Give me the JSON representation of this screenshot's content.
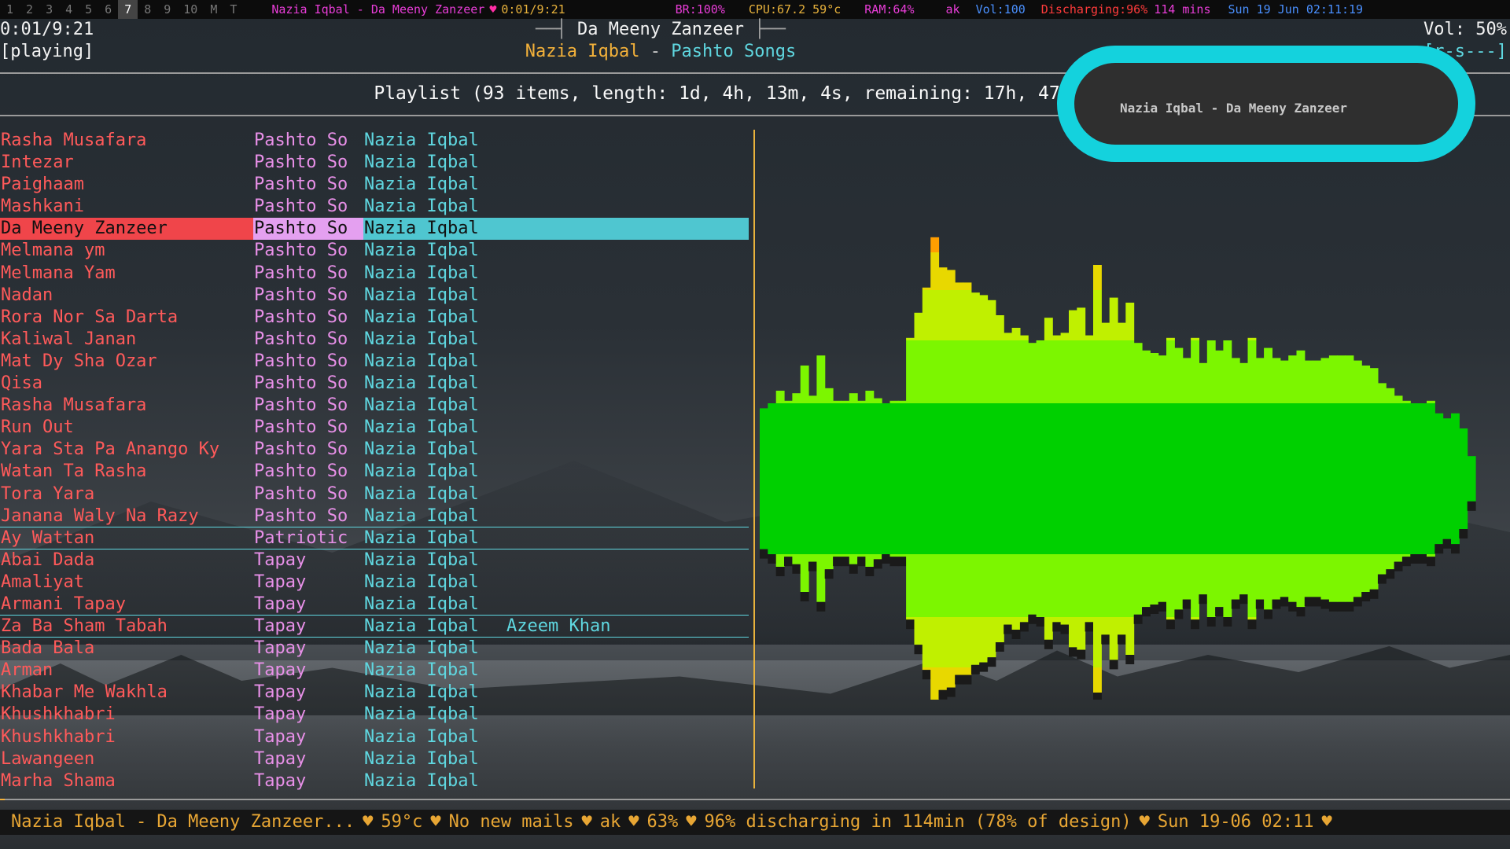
{
  "topbar": {
    "workspaces": [
      "1",
      "2",
      "3",
      "4",
      "5",
      "6",
      "7",
      "8",
      "9",
      "10",
      "M",
      "T"
    ],
    "active_workspace": "7",
    "now_playing": "Nazia Iqbal - Da Meeny Zanzeer",
    "heart": "♥",
    "time": "0:01/9:21",
    "brightness": "BR:100%",
    "cpu": "CPU:67.2 59°c",
    "ram": "RAM:64%",
    "user": "ak",
    "volume": "Vol:100",
    "battery_label": "Discharging:",
    "battery_pct": "96%",
    "battery_time": "114 mins",
    "datetime": "Sun 19 Jun 02:11:19"
  },
  "player": {
    "elapsed": "0:01/9:21",
    "state": "[playing]",
    "title": "Da Meeny Zanzeer",
    "artist": "Nazia Iqbal",
    "separator": "-",
    "album": "Pashto Songs",
    "volume": "Vol: 50%",
    "flags": "[r-s---]",
    "progress": 0.002
  },
  "playlist": {
    "header": "Playlist (93 items, length: 1d, 4h, 13m, 4s, remaining: 17h, 47m, 53s)",
    "rows": [
      {
        "title": "Rasha Musafara",
        "album": "Pashto So",
        "artist": "Nazia Iqbal",
        "extra": ""
      },
      {
        "title": "Intezar",
        "album": "Pashto So",
        "artist": "Nazia Iqbal",
        "extra": ""
      },
      {
        "title": "Paighaam",
        "album": "Pashto So",
        "artist": "Nazia Iqbal",
        "extra": ""
      },
      {
        "title": "Mashkani",
        "album": "Pashto So",
        "artist": "Nazia Iqbal",
        "extra": ""
      },
      {
        "title": "Da Meeny Zanzeer",
        "album": "Pashto So",
        "artist": "Nazia Iqbal",
        "extra": "",
        "selected": true
      },
      {
        "title": "Melmana ym",
        "album": "Pashto So",
        "artist": "Nazia Iqbal",
        "extra": ""
      },
      {
        "title": "Melmana Yam",
        "album": "Pashto So",
        "artist": "Nazia Iqbal",
        "extra": ""
      },
      {
        "title": "Nadan",
        "album": "Pashto So",
        "artist": "Nazia Iqbal",
        "extra": ""
      },
      {
        "title": "Rora Nor Sa Darta",
        "album": "Pashto So",
        "artist": "Nazia Iqbal",
        "extra": ""
      },
      {
        "title": "Kaliwal Janan",
        "album": "Pashto So",
        "artist": "Nazia Iqbal",
        "extra": ""
      },
      {
        "title": "Mat Dy Sha Ozar",
        "album": "Pashto So",
        "artist": "Nazia Iqbal",
        "extra": ""
      },
      {
        "title": "Qisa",
        "album": "Pashto So",
        "artist": "Nazia Iqbal",
        "extra": ""
      },
      {
        "title": "Rasha Musafara",
        "album": "Pashto So",
        "artist": "Nazia Iqbal",
        "extra": ""
      },
      {
        "title": "Run Out",
        "album": "Pashto So",
        "artist": "Nazia Iqbal",
        "extra": ""
      },
      {
        "title": "Yara Sta Pa Anango Ky",
        "album": "Pashto So",
        "artist": "Nazia Iqbal",
        "extra": ""
      },
      {
        "title": "Watan Ta Rasha",
        "album": "Pashto So",
        "artist": "Nazia Iqbal",
        "extra": ""
      },
      {
        "title": "Tora Yara",
        "album": "Pashto So",
        "artist": "Nazia Iqbal",
        "extra": ""
      },
      {
        "title": "Janana Waly Na Razy",
        "album": "Pashto So",
        "artist": "Nazia Iqbal",
        "extra": "",
        "underline": true
      },
      {
        "title": "Ay Wattan",
        "album": "Patriotic",
        "artist": "Nazia Iqbal",
        "extra": "",
        "underline": true
      },
      {
        "title": "Abai Dada",
        "album": "Tapay",
        "artist": "Nazia Iqbal",
        "extra": ""
      },
      {
        "title": "Amaliyat",
        "album": "Tapay",
        "artist": "Nazia Iqbal",
        "extra": ""
      },
      {
        "title": "Armani Tapay",
        "album": "Tapay",
        "artist": "Nazia Iqbal",
        "extra": "",
        "underline": true
      },
      {
        "title": "Za Ba Sham Tabah",
        "album": "Tapay",
        "artist": "Nazia Iqbal",
        "extra": "Azeem Khan",
        "underline": true
      },
      {
        "title": "Bada Bala",
        "album": "Tapay",
        "artist": "Nazia Iqbal",
        "extra": ""
      },
      {
        "title": "Arman",
        "album": "Tapay",
        "artist": "Nazia Iqbal",
        "extra": ""
      },
      {
        "title": "Khabar Me Wakhla",
        "album": "Tapay",
        "artist": "Nazia Iqbal",
        "extra": ""
      },
      {
        "title": "Khushkhabri",
        "album": "Tapay",
        "artist": "Nazia Iqbal",
        "extra": ""
      },
      {
        "title": "Khushkhabri",
        "album": "Tapay",
        "artist": "Nazia Iqbal",
        "extra": ""
      },
      {
        "title": "Lawangeen",
        "album": "Tapay",
        "artist": "Nazia Iqbal",
        "extra": ""
      },
      {
        "title": "Marha Shama",
        "album": "Tapay",
        "artist": "Nazia Iqbal",
        "extra": ""
      }
    ]
  },
  "visualizer": {
    "levels": [
      0.28,
      0.3,
      0.35,
      0.31,
      0.34,
      0.45,
      0.33,
      0.49,
      0.36,
      0.31,
      0.31,
      0.34,
      0.31,
      0.35,
      0.32,
      0.3,
      0.31,
      0.31,
      0.56,
      0.66,
      0.76,
      0.96,
      0.84,
      0.83,
      0.78,
      0.78,
      0.74,
      0.73,
      0.71,
      0.65,
      0.58,
      0.6,
      0.57,
      0.54,
      0.55,
      0.64,
      0.57,
      0.58,
      0.67,
      0.68,
      0.57,
      0.85,
      0.62,
      0.72,
      0.62,
      0.7,
      0.54,
      0.51,
      0.5,
      0.49,
      0.56,
      0.52,
      0.48,
      0.56,
      0.46,
      0.55,
      0.51,
      0.55,
      0.48,
      0.46,
      0.56,
      0.48,
      0.52,
      0.48,
      0.47,
      0.49,
      0.51,
      0.47,
      0.47,
      0.48,
      0.49,
      0.49,
      0.49,
      0.47,
      0.45,
      0.44,
      0.38,
      0.36,
      0.33,
      0.31,
      0.3,
      0.3,
      0.31,
      0.26,
      0.24,
      0.26,
      0.2,
      0.09
    ],
    "colors": {
      "core": "#00d000",
      "mid": "#7cf600",
      "upper": "#c0f000",
      "yellow": "#e8d800",
      "orange": "#ff9e00",
      "tip": "#1a1a1a"
    }
  },
  "notification": {
    "text": "Nazia Iqbal - Da Meeny Zanzeer"
  },
  "bottombar": {
    "segments": [
      "Nazia Iqbal - Da Meeny Zanzeer...",
      "59°c",
      "No new mails",
      "ak",
      "63%",
      "96% discharging in 114min (78% of design)",
      "Sun 19-06 02:11"
    ],
    "heart": "♥"
  }
}
